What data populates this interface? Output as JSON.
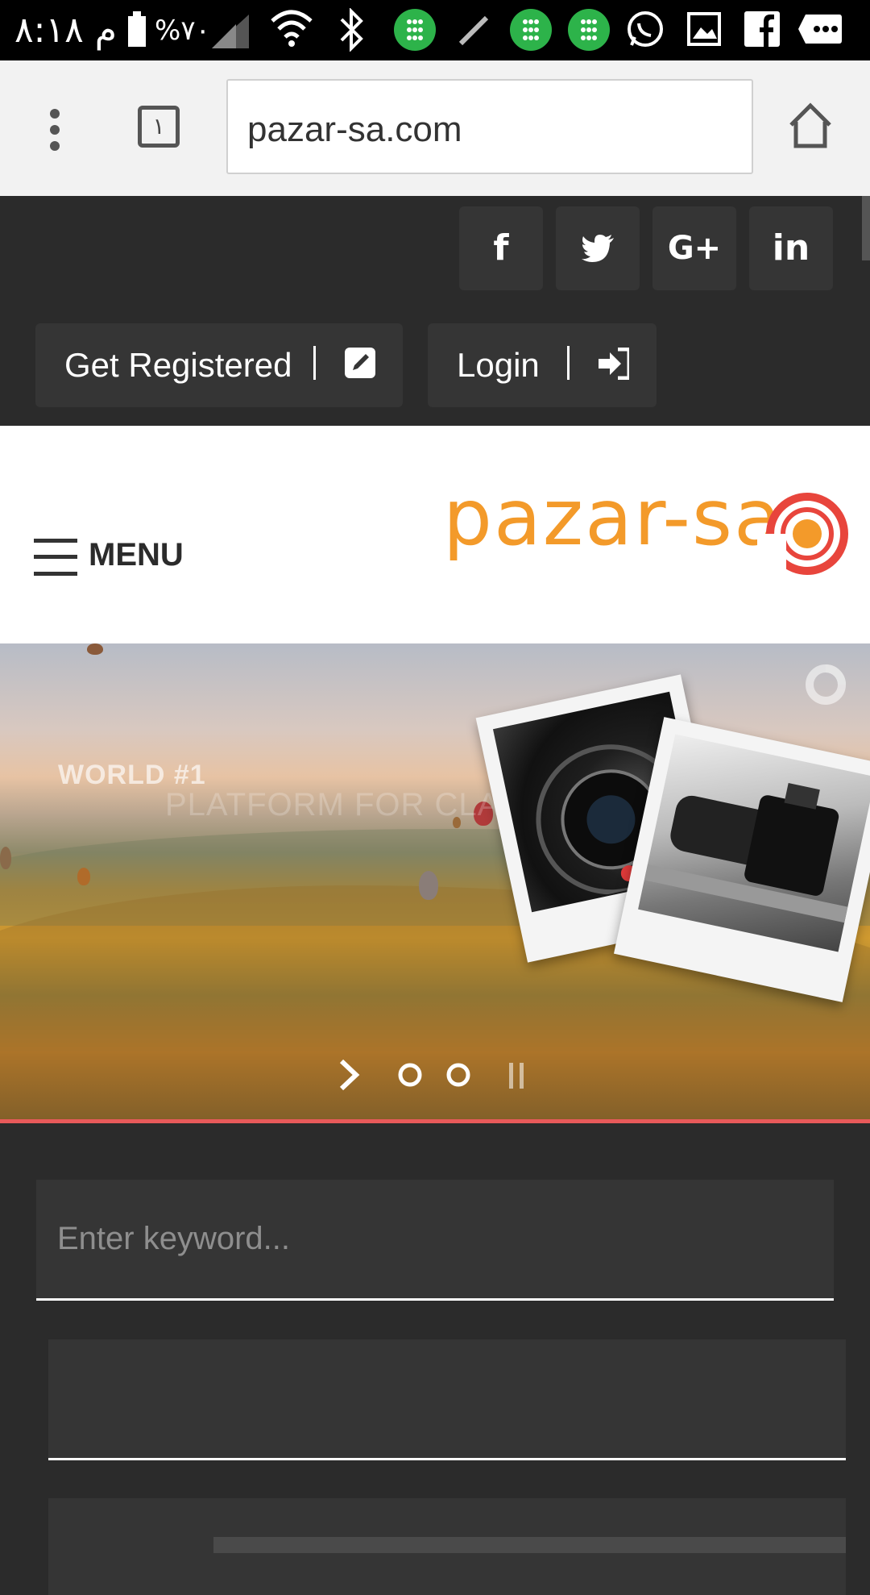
{
  "status_bar": {
    "time": "م ٨:١٨",
    "battery_percent": "%٧٠",
    "icons": [
      "battery-icon",
      "signal-icon",
      "wifi-icon",
      "bluetooth-icon",
      "app-notification-icon",
      "pin-icon",
      "whatsapp-icon",
      "gallery-icon",
      "facebook-icon",
      "more-icon"
    ]
  },
  "browser": {
    "url": "pazar-sa.com",
    "tab_count": "١"
  },
  "social": [
    "facebook-icon",
    "twitter-icon",
    "google-plus-icon",
    "linkedin-icon"
  ],
  "social_glyphs": {
    "facebook": "f",
    "google_plus": "G+",
    "linkedin": "in"
  },
  "auth": {
    "register_label": "Get Registered",
    "login_label": "Login"
  },
  "header": {
    "menu_label": "MENU",
    "logo_text": "pazar-sa"
  },
  "hero": {
    "title": "WORLD #1",
    "subtitle": "PLATFORM FOR CLASSIFIED"
  },
  "search": {
    "keyword_placeholder": "Enter keyword..."
  },
  "colors": {
    "dark_bg": "#2b2b2b",
    "button_bg": "#353535",
    "accent_red": "#e85a5a",
    "logo_orange": "#f39a2a"
  }
}
